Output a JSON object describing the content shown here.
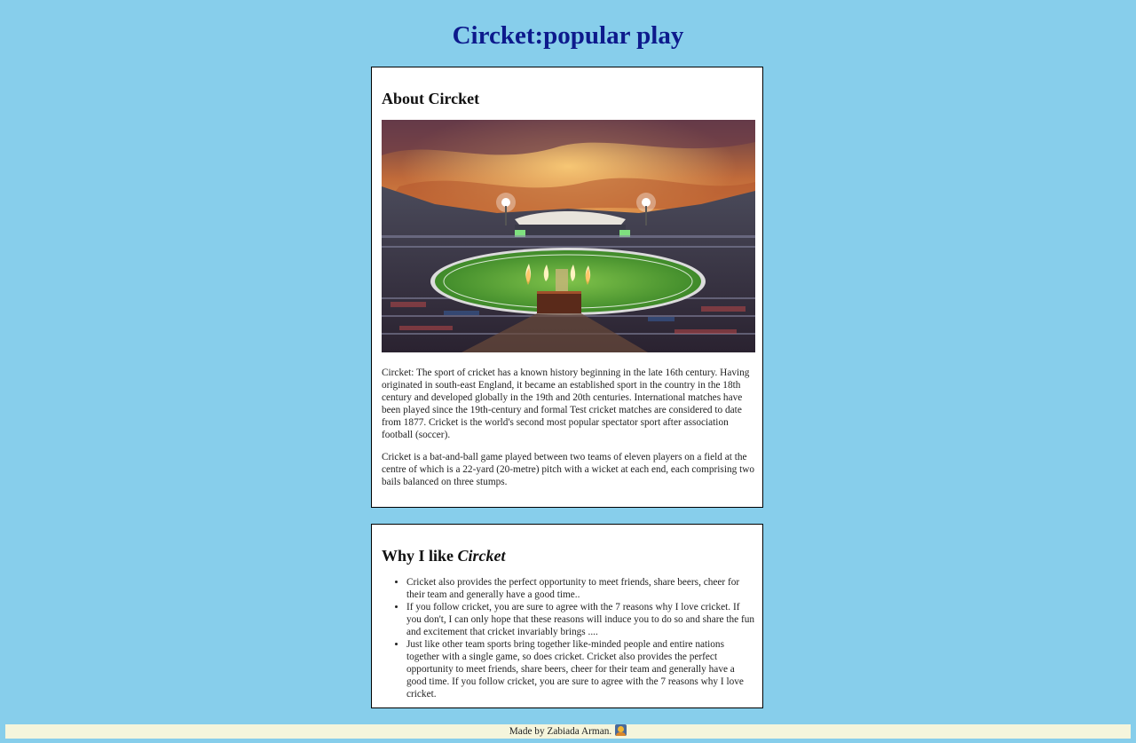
{
  "page": {
    "title": "Circket:popular play"
  },
  "about": {
    "heading": "About Circket",
    "image_alt": "cricket stadium at sunset",
    "paragraph_1": "Circket: The sport of cricket has a known history beginning in the late 16th century. Having originated in south-east England, it became an established sport in the country in the 18th century and developed globally in the 19th and 20th centuries. International matches have been played since the 19th-century and formal Test cricket matches are considered to date from 1877. Cricket is the world's second most popular spectator sport after association football (soccer).",
    "paragraph_2": "Cricket is a bat-and-ball game played between two teams of eleven players on a field at the centre of which is a 22-yard (20-metre) pitch with a wicket at each end, each comprising two bails balanced on three stumps."
  },
  "why": {
    "heading_prefix": "Why I like ",
    "heading_emphasis": "Circket",
    "reasons": [
      "Cricket also provides the perfect opportunity to meet friends, share beers, cheer for their team and generally have a good time..",
      "If you follow cricket, you are sure to agree with the 7 reasons why I love cricket. If you don't, I can only hope that these reasons will induce you to do so and share the fun and excitement that cricket invariably brings ....",
      "Just like other team sports bring together like-minded people and entire nations together with a single game, so does cricket. Cricket also provides the perfect opportunity to meet friends, share beers, cheer for their team and generally have a good time. If you follow cricket, you are sure to agree with the 7 reasons why I love cricket."
    ]
  },
  "footer": {
    "text": "Made by Zabiada Arman.",
    "emoji_icon": "sunset-emoji-icon"
  },
  "colors": {
    "background": "#87CEEB",
    "title": "#0d1a8c",
    "footer_bg": "#F5F5DC"
  }
}
